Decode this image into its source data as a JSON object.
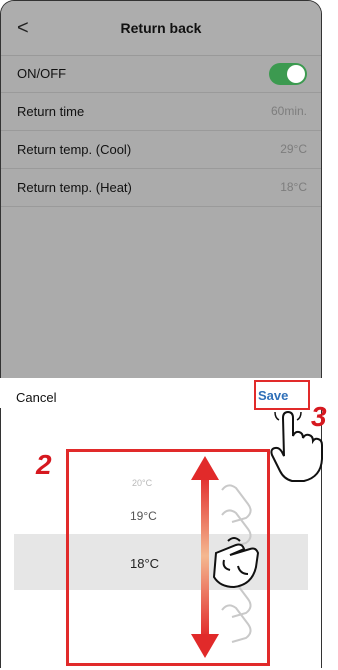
{
  "header": {
    "title": "Return back",
    "back_label": "<"
  },
  "settings": [
    {
      "label": "ON/OFF",
      "value": ""
    },
    {
      "label": "Return time",
      "value": "60min."
    },
    {
      "label": "Return temp. (Cool)",
      "value": "29°C"
    },
    {
      "label": "Return temp. (Heat)",
      "value": "18°C"
    }
  ],
  "picker": {
    "cancel_label": "Cancel",
    "save_label": "Save",
    "options": [
      "20°C",
      "19°C",
      "18°C"
    ],
    "selected": "18°C"
  },
  "annotations": {
    "step2": "2",
    "step3": "3"
  },
  "colors": {
    "accent_red": "#e12a2a",
    "toggle_green": "#3c9a50",
    "save_blue": "#2f6fb8"
  }
}
